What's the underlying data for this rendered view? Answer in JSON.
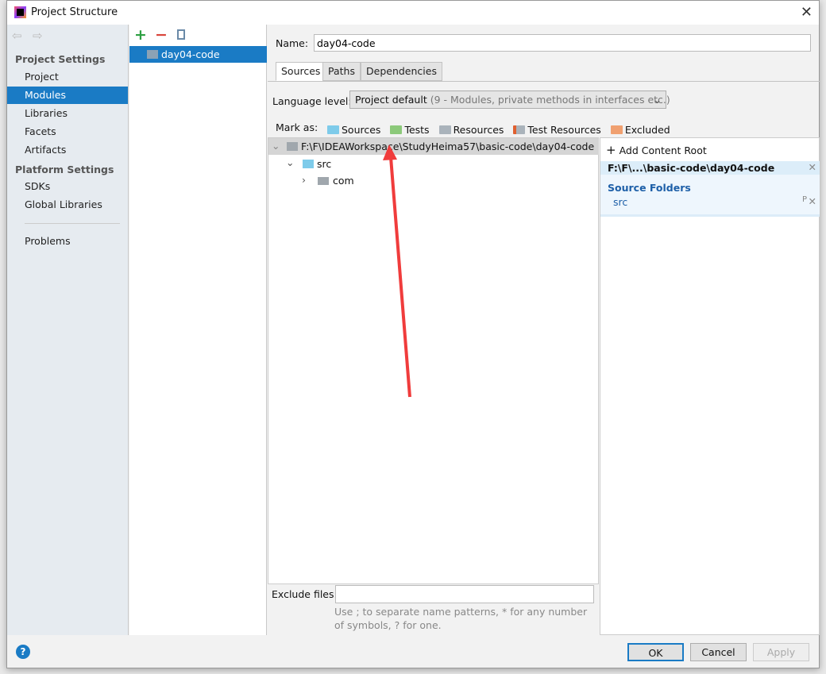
{
  "window": {
    "title": "Project Structure"
  },
  "sidebar": {
    "project_settings": "Project Settings",
    "items1": [
      "Project",
      "Modules",
      "Libraries",
      "Facets",
      "Artifacts"
    ],
    "platform_settings": "Platform Settings",
    "items2": [
      "SDKs",
      "Global Libraries"
    ],
    "problems": "Problems",
    "selected": "Modules"
  },
  "modules": {
    "items": [
      "day04-code"
    ]
  },
  "main": {
    "name_label": "Name:",
    "name_value": "day04-code",
    "tabs": [
      "Sources",
      "Paths",
      "Dependencies"
    ],
    "language_label": "Language level:",
    "language_value": "Project default",
    "language_detail": "(9 - Modules, private methods in interfaces etc.)",
    "mark_as": "Mark as:",
    "marks": [
      {
        "label": "Sources",
        "color": "#7ecbea"
      },
      {
        "label": "Tests",
        "color": "#8cc97a"
      },
      {
        "label": "Resources",
        "color": "#aab3bb"
      },
      {
        "label": "Test Resources",
        "color": "#aab3bb"
      },
      {
        "label": "Excluded",
        "color": "#f0a070"
      }
    ],
    "tree": {
      "root": "F:\\F\\IDEAWorkspace\\StudyHeima57\\basic-code\\day04-code",
      "src": "src",
      "com": "com"
    },
    "exclude_label": "Exclude files:",
    "exclude_value": "",
    "hint": "Use ; to separate name patterns, * for any number of symbols, ? for one."
  },
  "content_root": {
    "add": "Add Content Root",
    "path": "F:\\F\\...\\basic-code\\day04-code",
    "source_folders": "Source Folders",
    "src": "src"
  },
  "footer": {
    "ok": "OK",
    "cancel": "Cancel",
    "apply": "Apply"
  },
  "colors": {
    "accent": "#1a7bc5",
    "arrow": "#f03c3c"
  }
}
